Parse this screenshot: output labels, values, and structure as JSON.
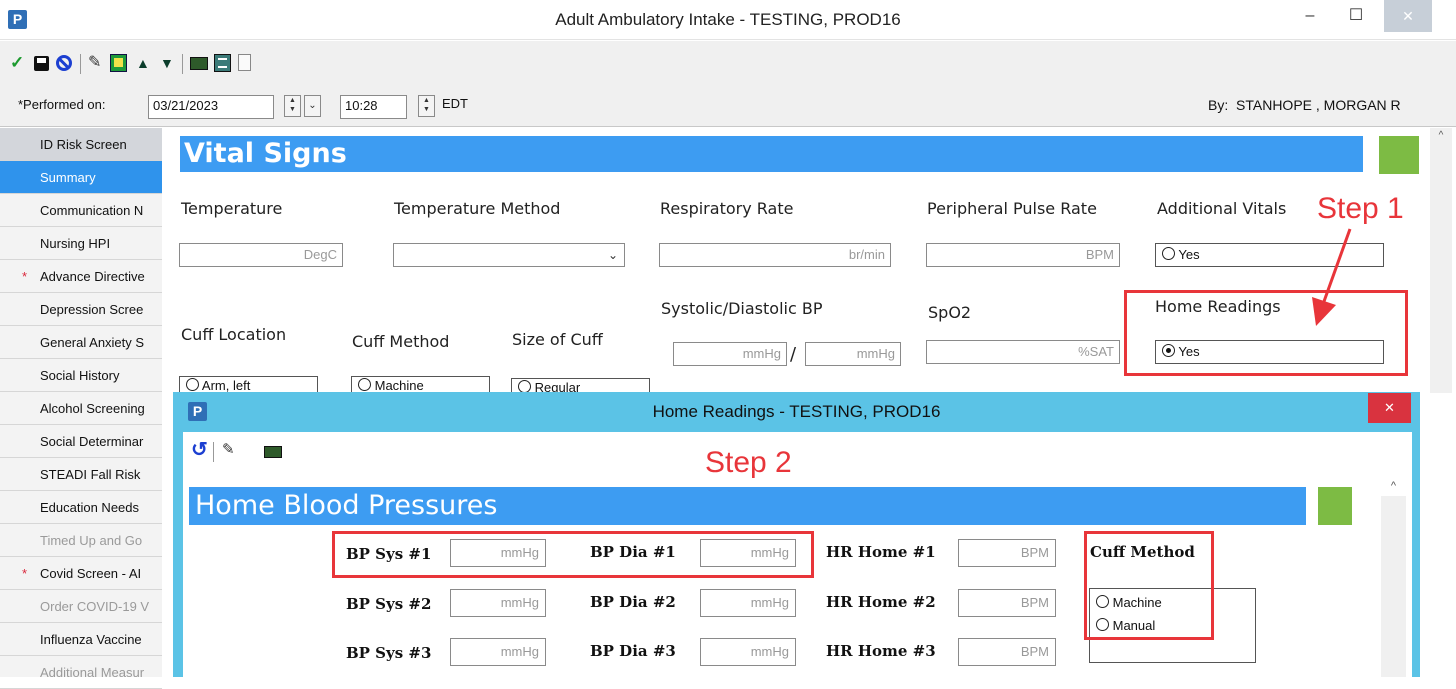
{
  "window": {
    "title": "Adult Ambulatory Intake - TESTING, PROD16",
    "app_icon": "P",
    "minimize": "–",
    "maximize": "☐",
    "close": "✕"
  },
  "toolbar": {
    "icons": [
      "check-icon",
      "save-icon",
      "cancel-icon",
      "sign-icon",
      "calendar-icon",
      "up-arrow-icon",
      "down-arrow-icon",
      "calculator-icon",
      "list-icon",
      "document-icon"
    ]
  },
  "performed": {
    "label": "*Performed on:",
    "date": "03/21/2023",
    "time": "10:28",
    "timezone": "EDT",
    "by_label": "By:",
    "by_name": "STANHOPE , MORGAN R"
  },
  "sidebar": {
    "items": [
      {
        "label": "ID Risk Screen",
        "state": "header"
      },
      {
        "label": "Summary",
        "state": "selected"
      },
      {
        "label": "Communication N",
        "state": "normal"
      },
      {
        "label": "Nursing HPI",
        "state": "normal"
      },
      {
        "label": "Advance Directive",
        "state": "required"
      },
      {
        "label": "Depression Scree",
        "state": "normal"
      },
      {
        "label": "General Anxiety S",
        "state": "normal"
      },
      {
        "label": "Social History",
        "state": "normal"
      },
      {
        "label": "Alcohol Screening",
        "state": "normal"
      },
      {
        "label": "Social Determinar",
        "state": "normal"
      },
      {
        "label": "STEADI Fall Risk",
        "state": "normal"
      },
      {
        "label": "Education Needs",
        "state": "normal"
      },
      {
        "label": "Timed Up and Go",
        "state": "disabled"
      },
      {
        "label": "Covid Screen - AI",
        "state": "required"
      },
      {
        "label": "Order COVID-19 V",
        "state": "disabled"
      },
      {
        "label": "Influenza Vaccine",
        "state": "normal"
      },
      {
        "label": "Additional Measur",
        "state": "disabled"
      }
    ],
    "required_marker": "*"
  },
  "vital_signs": {
    "title": "Vital Signs",
    "temperature": {
      "label": "Temperature",
      "unit": "DegC"
    },
    "temperature_method": {
      "label": "Temperature Method",
      "value": ""
    },
    "respiratory_rate": {
      "label": "Respiratory Rate",
      "unit": "br/min"
    },
    "peripheral_pulse": {
      "label": "Peripheral Pulse Rate",
      "unit": "BPM"
    },
    "additional_vitals": {
      "label": "Additional Vitals",
      "option": "Yes",
      "checked": false
    },
    "systolic_diastolic": {
      "label": "Systolic/Diastolic BP",
      "unit": "mmHg",
      "separator": "/"
    },
    "spo2": {
      "label": "SpO2",
      "unit": "%SAT"
    },
    "home_readings": {
      "label": "Home Readings",
      "option": "Yes",
      "checked": true
    },
    "cuff_location": {
      "label": "Cuff Location",
      "option": "Arm, left"
    },
    "cuff_method": {
      "label": "Cuff Method",
      "option": "Machine"
    },
    "size_of_cuff": {
      "label": "Size of Cuff",
      "option": "Regular"
    }
  },
  "annotations": {
    "step1": "Step 1",
    "step2": "Step 2"
  },
  "popup": {
    "title": "Home Readings - TESTING, PROD16",
    "close": "✕",
    "section_title": "Home Blood Pressures",
    "rows": [
      {
        "sys_label": "BP Sys #1",
        "dia_label": "BP Dia #1",
        "hr_label": "HR Home #1"
      },
      {
        "sys_label": "BP Sys #2",
        "dia_label": "BP Dia #2",
        "hr_label": "HR Home #2"
      },
      {
        "sys_label": "BP Sys #3",
        "dia_label": "BP Dia #3",
        "hr_label": "HR Home #3"
      }
    ],
    "bp_unit": "mmHg",
    "hr_unit": "BPM",
    "cuff_method": {
      "label": "Cuff Method",
      "options": [
        "Machine",
        "Manual"
      ]
    }
  },
  "colors": {
    "section_blue": "#3d9cf2",
    "accent_green": "#7dbb44",
    "annotation_red": "#e8353a",
    "dialog_frame": "#5bc3e6"
  }
}
